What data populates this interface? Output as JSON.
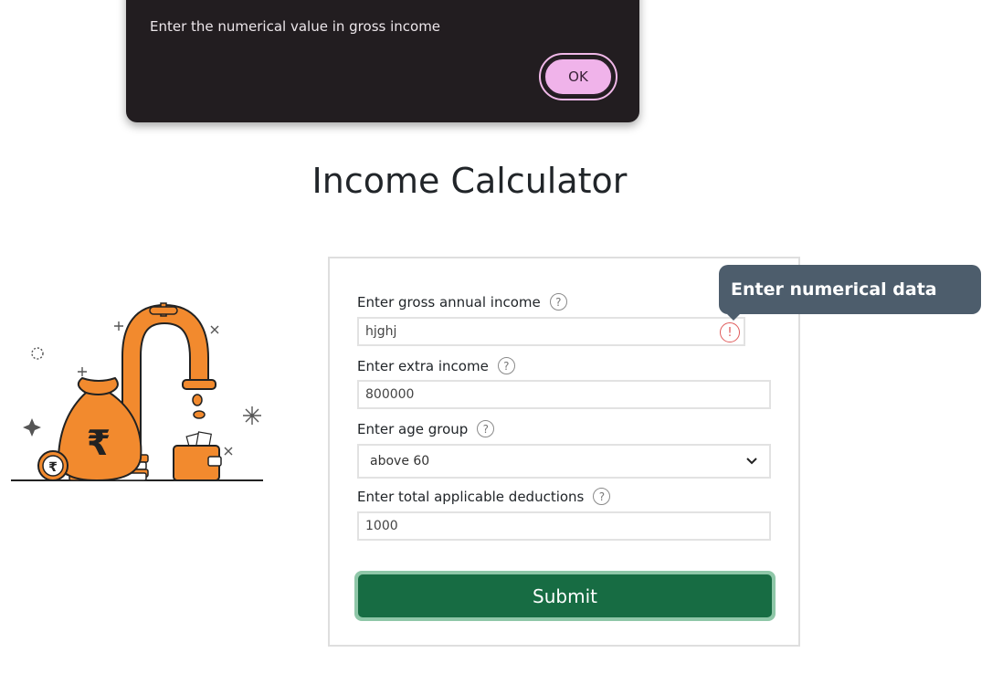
{
  "dialog": {
    "message": "Enter the numerical value in gross income",
    "ok_label": "OK"
  },
  "page_title": "Income Calculator",
  "form": {
    "gross_income": {
      "label": "Enter gross annual income",
      "value": "hjghj"
    },
    "extra_income": {
      "label": "Enter extra income",
      "value": "800000"
    },
    "age_group": {
      "label": "Enter age group",
      "selected": "above 60"
    },
    "deductions": {
      "label": "Enter total applicable deductions",
      "value": "1000"
    },
    "help_glyph": "?",
    "error_glyph": "!",
    "submit_label": "Submit"
  },
  "tooltip": {
    "text": "Enter numerical data"
  },
  "illustration": {
    "currency_symbol": "₹"
  },
  "colors": {
    "dialog_bg": "#221d20",
    "ok_button": "#f0b3ea",
    "submit_bg": "#176c43",
    "tooltip_bg": "#4d5d6c",
    "illustration_orange": "#f28a2e",
    "error": "#e05a5a"
  }
}
